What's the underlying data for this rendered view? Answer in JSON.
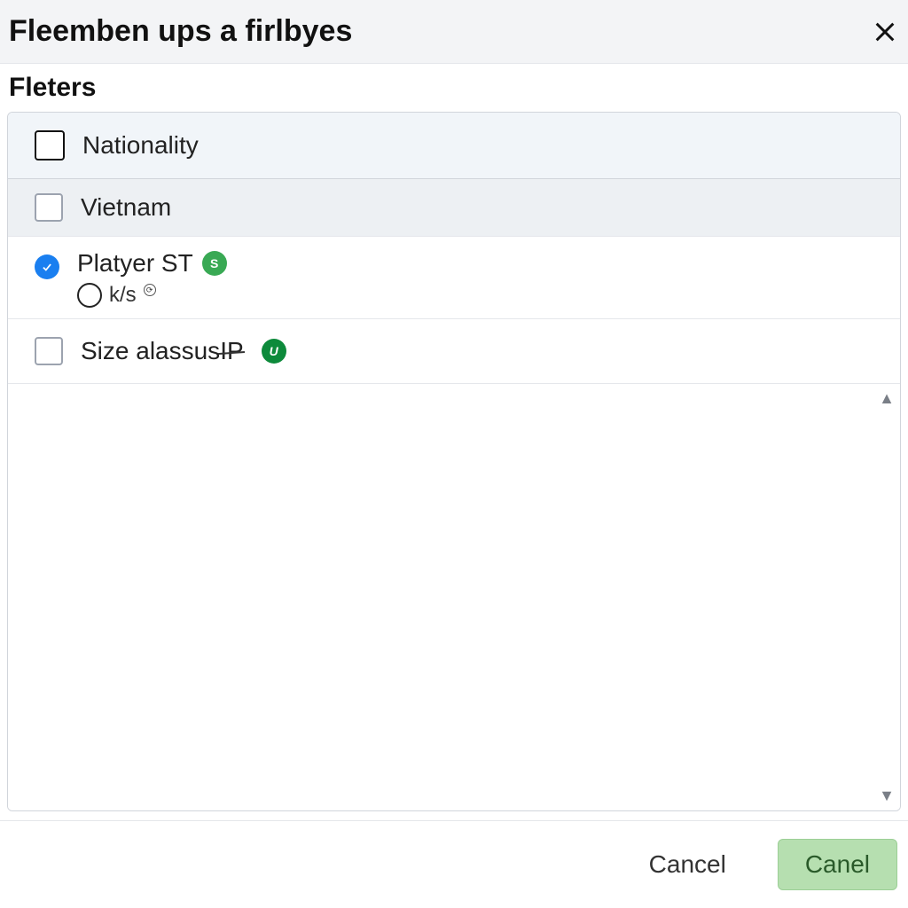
{
  "header": {
    "title": "Fleemben ups a firlbyes"
  },
  "section": {
    "title": "Fleters"
  },
  "filters": {
    "nationality": {
      "label": "Nationality",
      "checked": false
    },
    "vietnam": {
      "label": "Vietnam",
      "checked": false
    },
    "player": {
      "label": "Platyer ST",
      "badge": "S",
      "selected": true,
      "subline": "k/s"
    },
    "size": {
      "label_prefix": "Size alassus",
      "label_suffix": "IP",
      "badge": "U",
      "checked": false
    }
  },
  "footer": {
    "cancel": "Cancel",
    "confirm": "Canel"
  }
}
